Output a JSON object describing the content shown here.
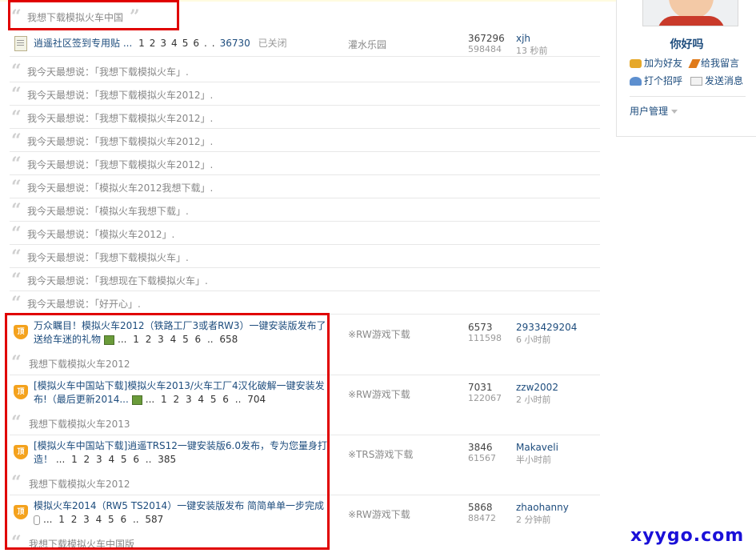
{
  "top_quote": "我想下载模拟火车中国",
  "pinned": {
    "title": "逍遥社区签到专用贴",
    "ellipsis": "...",
    "pages": [
      "1",
      "2",
      "3",
      "4",
      "5",
      "6",
      ".."
    ],
    "last_page": "36730",
    "closed": "已关闭",
    "forum": "灌水乐园",
    "replies": "367296",
    "views": "598484",
    "user": "xjh",
    "time": "13 秒前"
  },
  "quotes": [
    "我今天最想说：「我想下载模拟火车」.",
    "我今天最想说：「我想下载模拟火车2012」.",
    "我今天最想说：「我想下载模拟火车2012」.",
    "我今天最想说：「我想下载模拟火车2012」.",
    "我今天最想说：「我想下载模拟火车2012」.",
    "我今天最想说：「模拟火车2012我想下载」.",
    "我今天最想说：「模拟火车我想下载」.",
    "我今天最想说：「模拟火车2012」.",
    "我今天最想说：「我想下载模拟火车」.",
    "我今天最想说：「我想现在下载模拟火车」.",
    "我今天最想说：「好开心」."
  ],
  "threads": [
    {
      "icon_label": "顶",
      "title_line1": "万众瞩目！模拟火车2012（铁路工厂3或者RW3）一键安装版发布了！",
      "title_line2": "送给车迷的礼物",
      "pages": "... 1 2 3 4 5 6 .. 658",
      "sub_quote": "我想下载模拟火车2012",
      "forum": "※RW游戏下载",
      "replies": "6573",
      "views": "111598",
      "user": "2933429204",
      "time": "6 小时前"
    },
    {
      "icon_label": "顶",
      "title_line1": "[模拟火车中国站下载]模拟火车2013/火车工厂4汉化破解一键安装发",
      "title_line2": "布!（最后更新2014...",
      "pages": "... 1 2 3 4 5 6 .. 704",
      "sub_quote": "我想下载模拟火车2013",
      "forum": "※RW游戏下载",
      "replies": "7031",
      "views": "122067",
      "user": "zzw2002",
      "time": "2 小时前"
    },
    {
      "icon_label": "顶",
      "title_line1": "[模拟火车中国站下载]逍遥TRS12一键安装版6.0发布，专为您量身打",
      "title_line2": "造！",
      "pages": "... 1 2 3 4 5 6 .. 385",
      "sub_quote": "我想下载模拟火车2012",
      "forum": "※TRS游戏下载",
      "replies": "3846",
      "views": "61567",
      "user": "Makaveli",
      "time": "半小时前"
    },
    {
      "icon_label": "顶",
      "title_line1": "模拟火车2014（RW5 TS2014）一键安装版发布 简简单单一步完成",
      "title_line2": "",
      "pages": "... 1 2 3 4 5 6 .. 587",
      "sub_quote": "我想下载模拟火车中国版",
      "forum": "※RW游戏下载",
      "replies": "5868",
      "views": "88472",
      "user": "zhaohanny",
      "time": "2 分钟前"
    }
  ],
  "sidebar": {
    "greeting": "你好吗",
    "add_friend": "加为好友",
    "leave_message": "给我留言",
    "greet": "打个招呼",
    "send_message": "发送消息",
    "user_management": "用户管理"
  },
  "watermark": "xyygo.com",
  "colors": {
    "link": "#1d4c7d",
    "highlight_box": "#e00000",
    "watermark": "#1a10d8"
  }
}
